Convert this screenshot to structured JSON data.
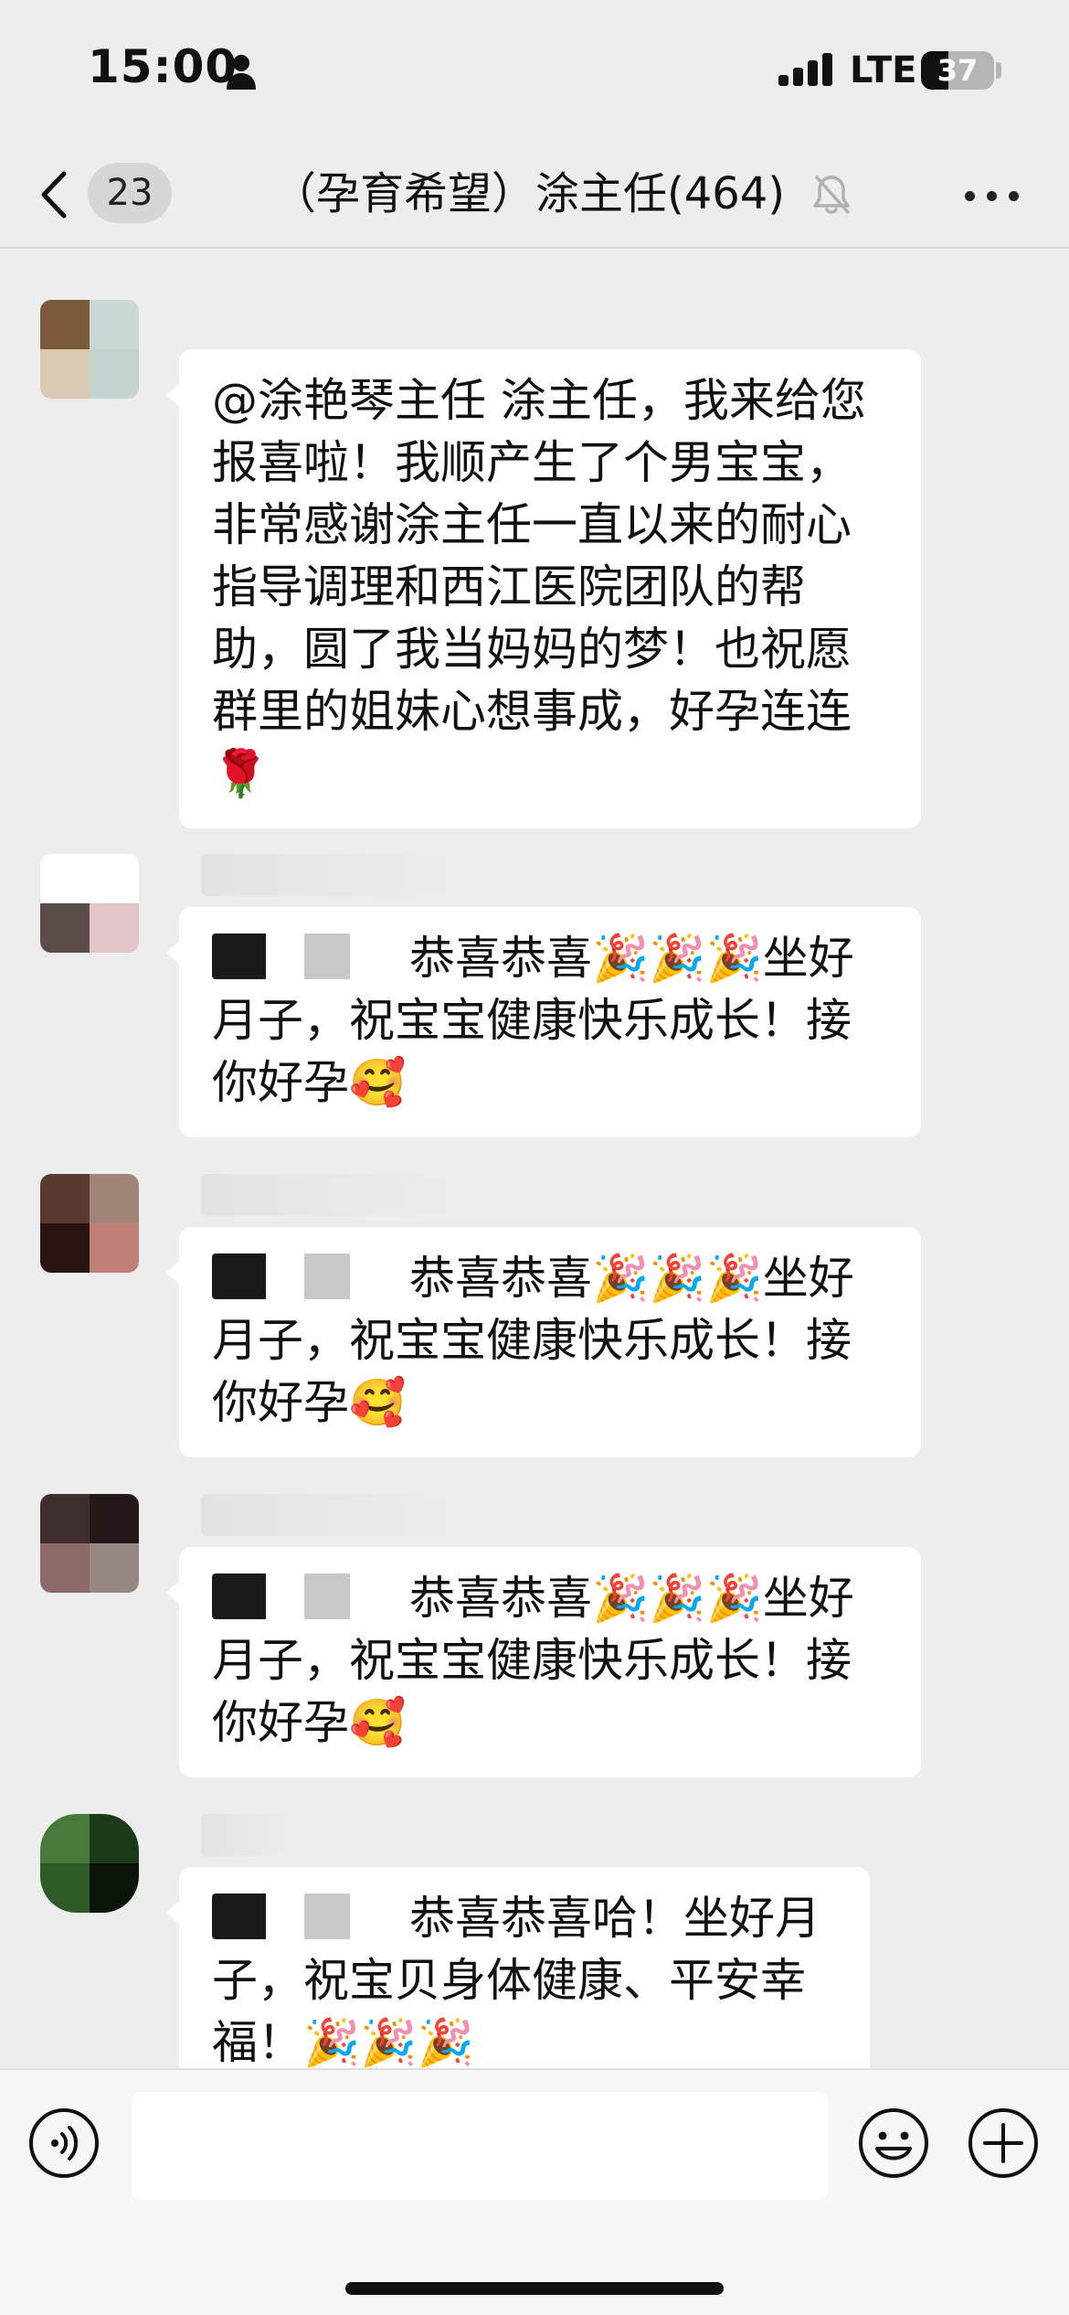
{
  "status_bar": {
    "time": "15:00",
    "network": "LTE",
    "battery_level": "37",
    "battery_percent": 37,
    "icons": [
      "person-icon",
      "cellular-signal-icon",
      "battery-icon"
    ]
  },
  "nav": {
    "unread_count": "23",
    "title": "（孕育希望）涂主任(464)",
    "icons": [
      "chevron-left-icon",
      "mute-bell-icon",
      "more-dots-icon"
    ]
  },
  "messages": [
    {
      "sender_masked": true,
      "avatar_colors": [
        "#7a5a3a",
        "#c9d9d6",
        "#d7c9b2",
        "#c5d4d1"
      ],
      "text": "@涂艳琴主任 涂主任，我来给您报喜啦！我顺产生了个男宝宝，非常感谢涂主任一直以来的耐心指导调理和西江医院团队的帮助，圆了我当妈妈的梦！也祝愿群里的姐妹心想事成，好孕连连🌹"
    },
    {
      "sender_masked": true,
      "avatar_colors": [
        "#5a4c48",
        "#e3c4c8",
        "#ffffff",
        "#ffffff"
      ],
      "mention_masked": true,
      "text": "恭喜恭喜🎉🎉🎉坐好月子，祝宝宝健康快乐成长！接你好孕🥰"
    },
    {
      "sender_masked": true,
      "avatar_colors": [
        "#5a3a30",
        "#a08478",
        "#2a1410",
        "#c08078"
      ],
      "mention_masked": true,
      "text": "恭喜恭喜🎉🎉🎉坐好月子，祝宝宝健康快乐成长！接你好孕🥰"
    },
    {
      "sender_masked": true,
      "avatar_colors": [
        "#3e2e2e",
        "#251818",
        "#8c6a68",
        "#968880"
      ],
      "mention_masked": true,
      "text": "恭喜恭喜🎉🎉🎉坐好月子，祝宝宝健康快乐成长！接你好孕🥰"
    },
    {
      "sender_masked": true,
      "avatar_colors": [
        "#4a7a3a",
        "#1a3a18",
        "#2e5a26",
        "#0a1408"
      ],
      "mention_masked": true,
      "text": "恭喜恭喜哈！坐好月子，祝宝贝身体健康、平安幸福！🎉🎉🎉"
    }
  ],
  "input_bar": {
    "placeholder": "",
    "icons": [
      "voice-icon",
      "emoji-icon",
      "plus-icon"
    ]
  }
}
